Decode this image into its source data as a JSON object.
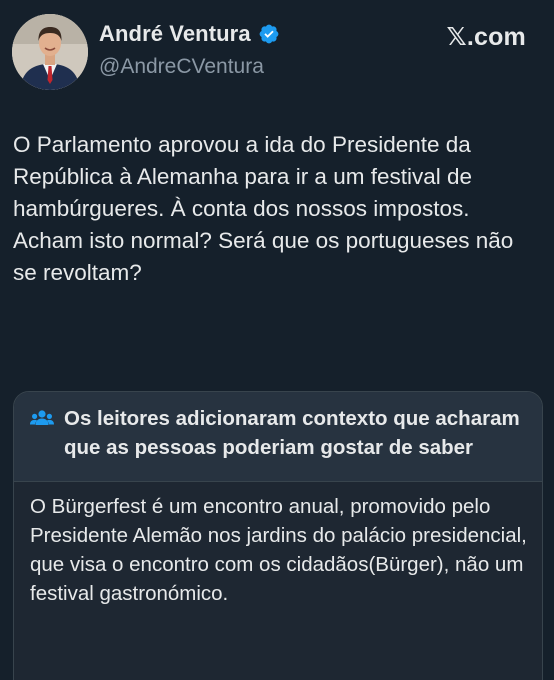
{
  "header": {
    "display_name": "André Ventura",
    "handle": "@AndreCVentura",
    "brand": "𝕏.com",
    "verified_color": "#1d9bf0"
  },
  "tweet": {
    "text": "O Parlamento aprovou a ida do Presidente da República à Alemanha para ir a um festival de hambúrgueres. À conta dos nossos impostos. Acham isto normal? Será que os portugueses não se revoltam?"
  },
  "community_note": {
    "title": "Os leitores adicionaram contexto que acharam que as pessoas poderiam gostar de saber",
    "body": "O Bürgerfest é um encontro anual, promovido pelo Presidente Alemão nos jardins do palácio presidencial, que visa o encontro com os cidadãos(Bürger), não um festival gastronómico.",
    "icon": "people-icon",
    "accent_color": "#1d9bf0"
  }
}
